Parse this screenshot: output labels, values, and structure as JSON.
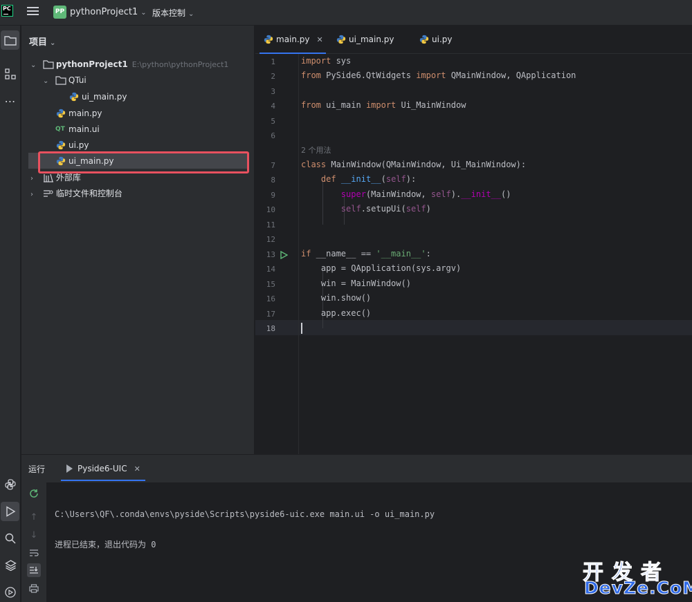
{
  "app": {
    "logo_text": "PC",
    "project_badge": "PP",
    "project_name": "pythonProject1",
    "vcs_label": "版本控制"
  },
  "project_panel": {
    "title": "项目",
    "tree": [
      {
        "label": "pythonProject1",
        "path": "E:\\python\\pythonProject1",
        "type": "folder",
        "expanded": true
      },
      {
        "label": "QTui",
        "type": "folder",
        "expanded": true
      },
      {
        "label": "ui_main.py",
        "type": "python"
      },
      {
        "label": "main.py",
        "type": "python"
      },
      {
        "label": "main.ui",
        "type": "qt"
      },
      {
        "label": "ui.py",
        "type": "python"
      },
      {
        "label": "ui_main.py",
        "type": "python",
        "selected": true
      },
      {
        "label": "外部库",
        "type": "library"
      },
      {
        "label": "临时文件和控制台",
        "type": "scratches"
      }
    ]
  },
  "editor": {
    "tabs": [
      {
        "label": "main.py",
        "active": true,
        "closable": true
      },
      {
        "label": "ui_main.py",
        "active": false
      },
      {
        "label": "ui.py",
        "active": false
      }
    ],
    "line_numbers": [
      "1",
      "2",
      "3",
      "4",
      "5",
      "6",
      "7",
      "8",
      "9",
      "10",
      "11",
      "12",
      "13",
      "14",
      "15",
      "16",
      "17",
      "18"
    ],
    "usage_hint": "2 个用法",
    "current_line": "18"
  },
  "run_panel": {
    "title": "运行",
    "tab_label": "Pyside6-UIC",
    "console_lines": [
      "C:\\Users\\QF\\.conda\\envs\\pyside\\Scripts\\pyside6-uic.exe main.ui -o ui_main.py",
      "进程已结束，退出代码为 0"
    ]
  },
  "watermark": {
    "cn": "开发者",
    "en": "DevZe.CoM"
  },
  "colors": {
    "accent": "#3574f0",
    "highlight_box": "#e8515f",
    "keyword": "#cf8e6d",
    "string": "#6aab73",
    "dunder": "#b200b2"
  }
}
